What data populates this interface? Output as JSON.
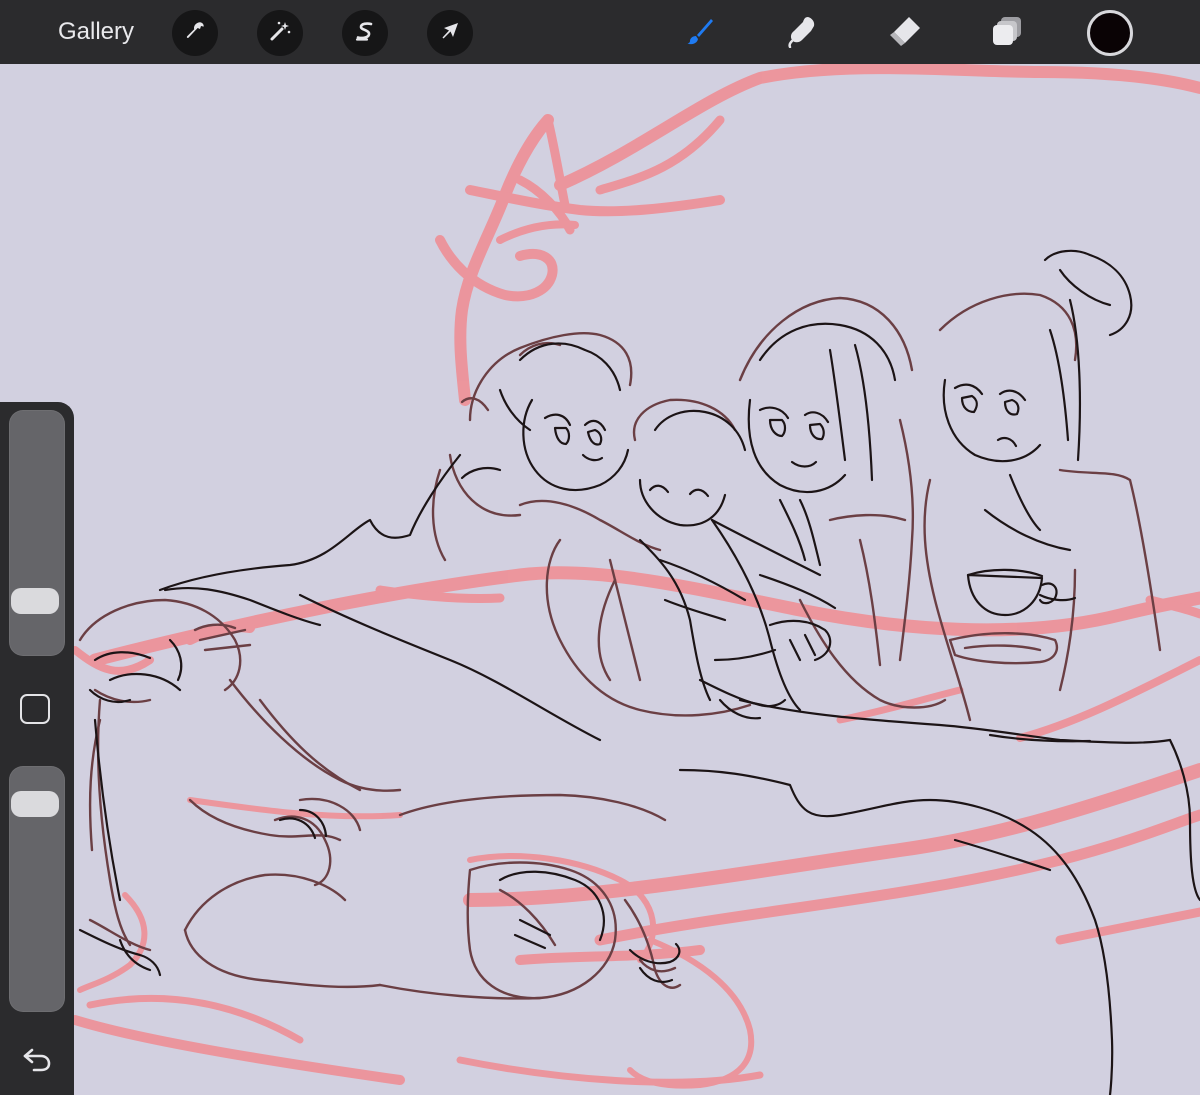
{
  "toolbar": {
    "gallery_label": "Gallery",
    "actions_icon": "wrench-icon",
    "adjustments_icon": "magic-wand-icon",
    "selection_icon": "selection-s-icon",
    "transform_icon": "arrow-cursor-icon",
    "brush_icon": "brush-icon",
    "smudge_icon": "smudge-finger-icon",
    "eraser_icon": "eraser-icon",
    "layers_icon": "layers-icon",
    "active_tool": "brush",
    "active_color": "#0a0305",
    "accent_color": "#1f7bf2"
  },
  "sidebar": {
    "brush_size_level": 0.18,
    "opacity_level": 0.1,
    "modify_icon": "square-icon",
    "undo_icon": "undo-arrow-icon"
  },
  "canvas": {
    "background_color": "#d2d0e0",
    "sketch_color": "#5a3a3e",
    "line_color": "#1c1416",
    "rough_color": "#ee8f96"
  }
}
